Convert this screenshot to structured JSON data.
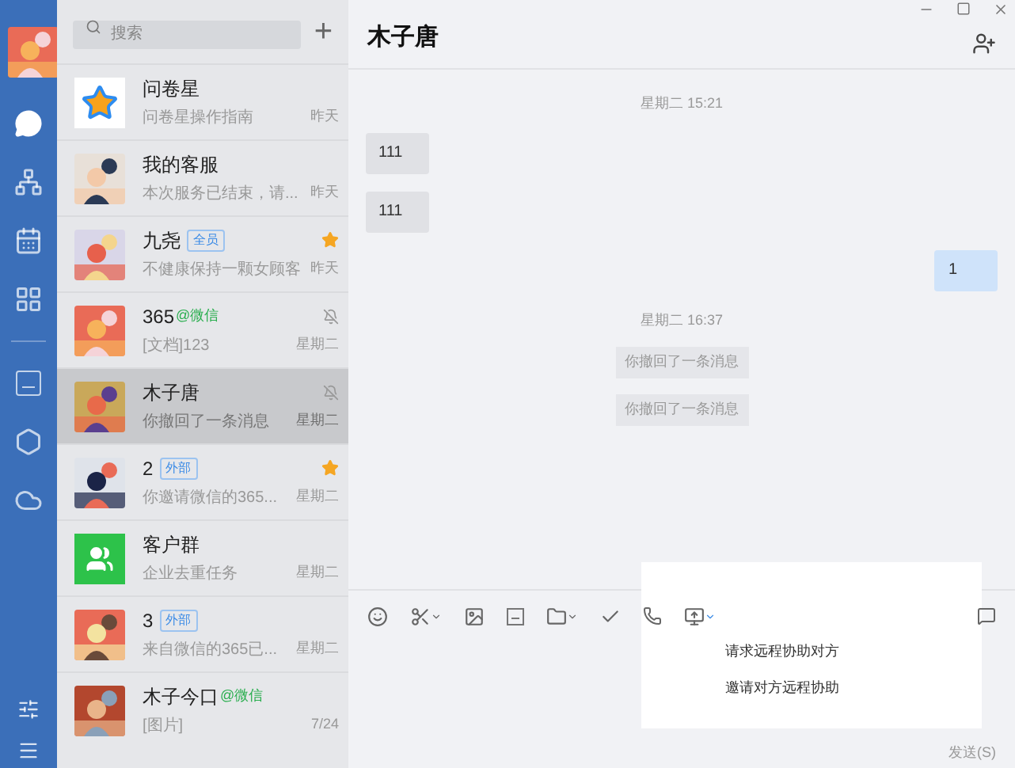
{
  "nav": {
    "items": [
      {
        "kind": "chat",
        "selected": true
      },
      {
        "kind": "org",
        "selected": false
      },
      {
        "kind": "calendar",
        "selected": false
      },
      {
        "kind": "apps",
        "selected": false
      },
      {
        "kind": "doc",
        "selected": false
      },
      {
        "kind": "hexagon",
        "selected": false
      },
      {
        "kind": "cloud",
        "selected": false
      }
    ]
  },
  "search": {
    "placeholder": "搜索",
    "add_label": "+"
  },
  "conversations": [
    {
      "avatar": {
        "kind": "star"
      },
      "name": "问卷星",
      "preview": "问卷星操作指南",
      "time": "昨天",
      "starred": false,
      "muted": false,
      "selected": false
    },
    {
      "name": "我的客服",
      "preview": "本次服务已结束，请...",
      "time": "昨天",
      "starred": false,
      "muted": false,
      "selected": false
    },
    {
      "name": "九尧",
      "tag": {
        "text": "全员",
        "kind": "badge"
      },
      "preview": "不健康保持一颗女顾客",
      "time": "昨天",
      "starred": true,
      "muted": false,
      "selected": false
    },
    {
      "name": "365",
      "tag": {
        "text": "@微信",
        "kind": "wechat"
      },
      "preview": "[文档]123",
      "time": "星期二",
      "starred": false,
      "muted": true,
      "selected": false
    },
    {
      "name": "木子唐",
      "preview": "你撤回了一条消息",
      "time": "星期二",
      "starred": false,
      "muted": true,
      "selected": true
    },
    {
      "name": "2",
      "tag": {
        "text": "外部",
        "kind": "badge"
      },
      "preview": "你邀请微信的365...",
      "time": "星期二",
      "starred": true,
      "muted": false,
      "selected": false
    },
    {
      "avatar": {
        "kind": "group"
      },
      "name": "客户群",
      "preview": "企业去重任务",
      "time": "星期二",
      "starred": false,
      "muted": false,
      "selected": false
    },
    {
      "name": "3",
      "tag": {
        "text": "外部",
        "kind": "badge"
      },
      "preview": "来自微信的365已...",
      "time": "星期二",
      "starred": false,
      "muted": false,
      "selected": false
    },
    {
      "name": "木子今口",
      "tag": {
        "text": "@微信",
        "kind": "wechat"
      },
      "preview": "[图片]",
      "time": "7/24",
      "starred": false,
      "muted": false,
      "selected": false
    }
  ],
  "chat": {
    "title": "木子唐",
    "messages": [
      {
        "kind": "time",
        "text": "星期二 15:21"
      },
      {
        "kind": "incoming",
        "text": "111"
      },
      {
        "kind": "incoming",
        "text": "111"
      },
      {
        "kind": "outgoing",
        "text": "1"
      },
      {
        "kind": "time",
        "text": "星期二 16:37"
      },
      {
        "kind": "notice",
        "text": "你撤回了一条消息"
      },
      {
        "kind": "notice",
        "text": "你撤回了一条消息"
      }
    ]
  },
  "menu": {
    "items": [
      "请求远程协助对方",
      "邀请对方远程协助"
    ]
  },
  "send_label": "发送(S)"
}
